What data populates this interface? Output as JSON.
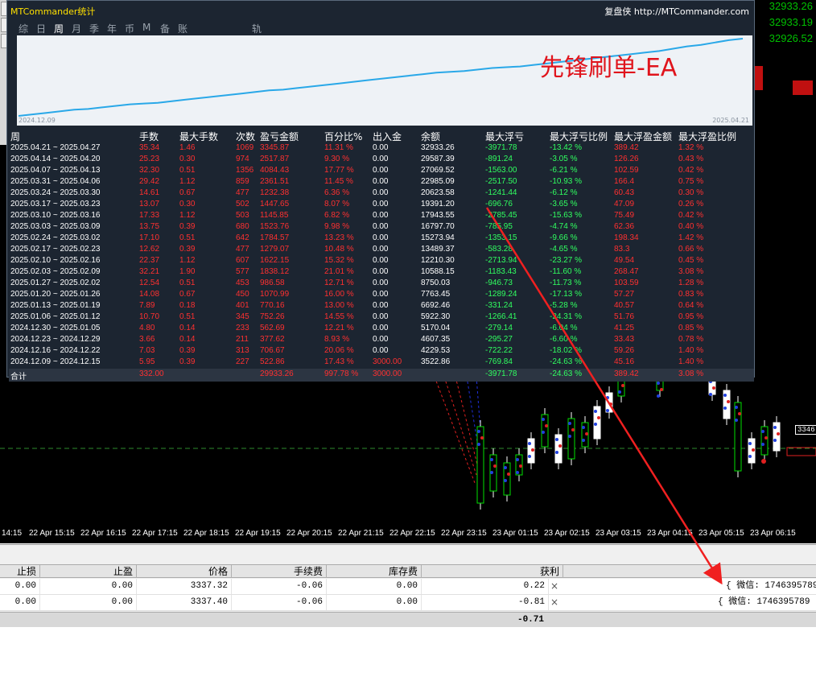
{
  "stats_window": {
    "title": "MTCommander统计",
    "brand": "复盘侠 http://MTCommander.com",
    "tabs": [
      "综",
      "日",
      "周",
      "月",
      "季",
      "年",
      "币",
      "M",
      "备",
      "账户",
      "轨迹"
    ],
    "active_tab": "周",
    "equity_start_date": "2024.12.09",
    "equity_end_date": "2025.04.21",
    "promo_text": "先锋刷单-EA",
    "colors": {
      "equity_line": "#29a8e8",
      "loss": "#ff3030",
      "drawdown": "#30ff60"
    },
    "headers": [
      "周",
      "手数",
      "最大手数",
      "次数",
      "盈亏金额",
      "百分比%",
      "出入金",
      "余额",
      "最大浮亏",
      "最大浮亏比例",
      "最大浮盈金额",
      "最大浮盈比例"
    ],
    "rows": [
      [
        "2025.04.21 ~ 2025.04.27",
        "35.34",
        "1.46",
        "1069",
        "3345.87",
        "11.31 %",
        "0.00",
        "32933.26",
        "-3971.78",
        "-13.42 %",
        "389.42",
        "1.32 %"
      ],
      [
        "2025.04.14 ~ 2025.04.20",
        "25.23",
        "0.30",
        "974",
        "2517.87",
        "9.30 %",
        "0.00",
        "29587.39",
        "-891.24",
        "-3.05 %",
        "126.26",
        "0.43 %"
      ],
      [
        "2025.04.07 ~ 2025.04.13",
        "32.30",
        "0.51",
        "1356",
        "4084.43",
        "17.77 %",
        "0.00",
        "27069.52",
        "-1563.00",
        "-6.21 %",
        "102.59",
        "0.42 %"
      ],
      [
        "2025.03.31 ~ 2025.04.06",
        "29.42",
        "1.12",
        "859",
        "2361.51",
        "11.45 %",
        "0.00",
        "22985.09",
        "-2517.50",
        "-10.93 %",
        "166.4",
        "0.75 %"
      ],
      [
        "2025.03.24 ~ 2025.03.30",
        "14.61",
        "0.67",
        "477",
        "1232.38",
        "6.36 %",
        "0.00",
        "20623.58",
        "-1241.44",
        "-6.12 %",
        "60.43",
        "0.30 %"
      ],
      [
        "2025.03.17 ~ 2025.03.23",
        "13.07",
        "0.30",
        "502",
        "1447.65",
        "8.07 %",
        "0.00",
        "19391.20",
        "-696.76",
        "-3.65 %",
        "47.09",
        "0.26 %"
      ],
      [
        "2025.03.10 ~ 2025.03.16",
        "17.33",
        "1.12",
        "503",
        "1145.85",
        "6.82 %",
        "0.00",
        "17943.55",
        "-2785.45",
        "-15.63 %",
        "75.49",
        "0.42 %"
      ],
      [
        "2025.03.03 ~ 2025.03.09",
        "13.75",
        "0.39",
        "680",
        "1523.76",
        "9.98 %",
        "0.00",
        "16797.70",
        "-785.95",
        "-4.74 %",
        "62.36",
        "0.40 %"
      ],
      [
        "2025.02.24 ~ 2025.03.02",
        "17.10",
        "0.51",
        "642",
        "1784.57",
        "13.23 %",
        "0.00",
        "15273.94",
        "-1353.15",
        "-9.66 %",
        "198.34",
        "1.42 %"
      ],
      [
        "2025.02.17 ~ 2025.02.23",
        "12.62",
        "0.39",
        "477",
        "1279.07",
        "10.48 %",
        "0.00",
        "13489.37",
        "-583.28",
        "-4.65 %",
        "83.3",
        "0.66 %"
      ],
      [
        "2025.02.10 ~ 2025.02.16",
        "22.37",
        "1.12",
        "607",
        "1622.15",
        "15.32 %",
        "0.00",
        "12210.30",
        "-2713.94",
        "-23.27 %",
        "49.54",
        "0.45 %"
      ],
      [
        "2025.02.03 ~ 2025.02.09",
        "32.21",
        "1.90",
        "577",
        "1838.12",
        "21.01 %",
        "0.00",
        "10588.15",
        "-1183.43",
        "-11.60 %",
        "268.47",
        "3.08 %"
      ],
      [
        "2025.01.27 ~ 2025.02.02",
        "12.54",
        "0.51",
        "453",
        "986.58",
        "12.71 %",
        "0.00",
        "8750.03",
        "-946.73",
        "-11.73 %",
        "103.59",
        "1.28 %"
      ],
      [
        "2025.01.20 ~ 2025.01.26",
        "14.08",
        "0.67",
        "450",
        "1070.99",
        "16.00 %",
        "0.00",
        "7763.45",
        "-1289.24",
        "-17.13 %",
        "57.27",
        "0.83 %"
      ],
      [
        "2025.01.13 ~ 2025.01.19",
        "7.89",
        "0.18",
        "401",
        "770.16",
        "13.00 %",
        "0.00",
        "6692.46",
        "-331.24",
        "-5.28 %",
        "40.57",
        "0.64 %"
      ],
      [
        "2025.01.06 ~ 2025.01.12",
        "10.70",
        "0.51",
        "345",
        "752.26",
        "14.55 %",
        "0.00",
        "5922.30",
        "-1266.41",
        "-24.31 %",
        "51.76",
        "0.95 %"
      ],
      [
        "2024.12.30 ~ 2025.01.05",
        "4.80",
        "0.14",
        "233",
        "562.69",
        "12.21 %",
        "0.00",
        "5170.04",
        "-279.14",
        "-6.04 %",
        "41.25",
        "0.85 %"
      ],
      [
        "2024.12.23 ~ 2024.12.29",
        "3.66",
        "0.14",
        "211",
        "377.62",
        "8.93 %",
        "0.00",
        "4607.35",
        "-295.27",
        "-6.60 %",
        "33.43",
        "0.78 %"
      ],
      [
        "2024.12.16 ~ 2024.12.22",
        "7.03",
        "0.39",
        "313",
        "706.67",
        "20.06 %",
        "0.00",
        "4229.53",
        "-722.22",
        "-18.02 %",
        "59.26",
        "1.40 %"
      ],
      [
        "2024.12.09 ~ 2024.12.15",
        "5.95",
        "0.39",
        "227",
        "522.86",
        "17.43 %",
        "3000.00",
        "3522.86",
        "-769.84",
        "-24.63 %",
        "45.16",
        "1.40 %"
      ]
    ],
    "total": {
      "label": "合计",
      "lots": "332.00",
      "profit": "29933.26",
      "percent": "997.78 %",
      "deposit": "3000.00",
      "max_drawdown": "-3971.78",
      "max_drawdown_pct": "-24.63 %",
      "max_float_profit": "389.42",
      "max_float_profit_pct": "3.08 %"
    }
  },
  "chart": {
    "price_labels": [
      "32933.26",
      "32933.19",
      "32926.52"
    ],
    "price_prefix_partial": "ir",
    "level_tag": "3346",
    "time_labels": [
      "14:15",
      "22 Apr 15:15",
      "22 Apr 16:15",
      "22 Apr 17:15",
      "22 Apr 18:15",
      "22 Apr 19:15",
      "22 Apr 20:15",
      "22 Apr 21:15",
      "22 Apr 22:15",
      "22 Apr 23:15",
      "23 Apr 01:15",
      "23 Apr 02:15",
      "23 Apr 03:15",
      "23 Apr 04:15",
      "23 Apr 05:15",
      "23 Apr 06:15"
    ],
    "equity_curve": [
      0,
      2,
      4,
      6,
      8,
      9,
      11,
      13,
      15,
      16,
      17,
      19,
      21,
      23,
      25,
      27,
      29,
      31,
      33,
      34,
      36,
      38,
      40,
      42,
      44,
      46,
      48,
      50,
      52,
      54,
      56,
      57,
      58,
      60,
      62,
      63,
      64,
      66,
      68,
      70,
      72,
      74,
      76,
      78,
      80,
      82,
      84,
      87,
      90,
      92,
      95,
      98,
      100
    ]
  },
  "terminal": {
    "headers": [
      "止损",
      "止盈",
      "价格",
      "手续费",
      "库存费",
      "获利"
    ],
    "rows": [
      {
        "sl": "0.00",
        "tp": "0.00",
        "price": "3337.32",
        "fee": "-0.06",
        "swap": "0.00",
        "profit": "0.22",
        "comment": "{ 微信: 1746395789-"
      },
      {
        "sl": "0.00",
        "tp": "0.00",
        "price": "3337.40",
        "fee": "-0.06",
        "swap": "0.00",
        "profit": "-0.81",
        "comment": "{ 微信: 1746395789 -S"
      }
    ],
    "total_profit": "-0.71"
  }
}
